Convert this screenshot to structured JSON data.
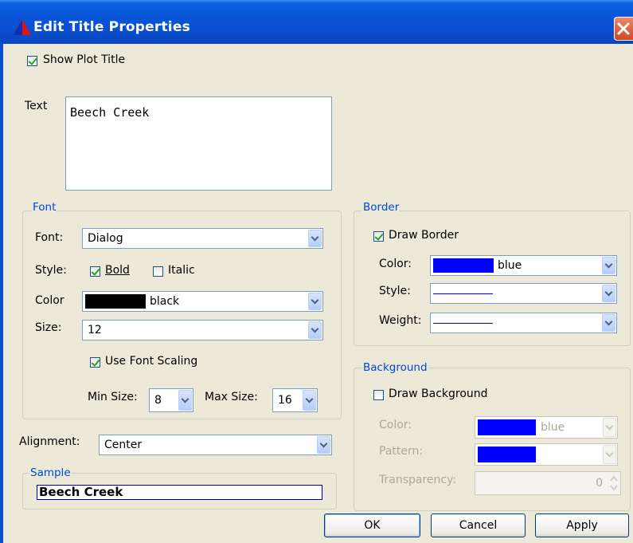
{
  "window": {
    "title": "Edit Title Properties"
  },
  "show_plot_title": {
    "label": "Show Plot Title",
    "checked": true
  },
  "text": {
    "label": "Text",
    "value": "Beech Creek"
  },
  "font_group": {
    "legend": "Font",
    "font_label": "Font:",
    "font_value": "Dialog",
    "style_label": "Style:",
    "bold_label": "Bold",
    "bold_checked": true,
    "italic_label": "Italic",
    "italic_checked": false,
    "color_label": "Color",
    "color_value": "black",
    "color_swatch": "#000000",
    "size_label": "Size:",
    "size_value": "12",
    "scaling_label": "Use Font Scaling",
    "scaling_checked": true,
    "min_label": "Min Size:",
    "min_value": "8",
    "max_label": "Max Size:",
    "max_value": "16"
  },
  "alignment": {
    "label": "Alignment:",
    "value": "Center"
  },
  "sample": {
    "legend": "Sample",
    "text": "Beech Creek"
  },
  "border_group": {
    "legend": "Border",
    "draw_label": "Draw Border",
    "draw_checked": true,
    "color_label": "Color:",
    "color_value": "blue",
    "color_swatch": "#0000ff",
    "style_label": "Style:",
    "weight_label": "Weight:"
  },
  "background_group": {
    "legend": "Background",
    "draw_label": "Draw Background",
    "draw_checked": false,
    "color_label": "Color:",
    "color_value": "blue",
    "color_swatch": "#0000ff",
    "pattern_label": "Pattern:",
    "transparency_label": "Transparency:",
    "transparency_value": "0"
  },
  "buttons": {
    "ok": "OK",
    "cancel": "Cancel",
    "apply": "Apply"
  },
  "colors": {
    "titlebar": "#0a54d8",
    "dialog_bg": "#ECE9D8",
    "accent": "#0046d5"
  }
}
